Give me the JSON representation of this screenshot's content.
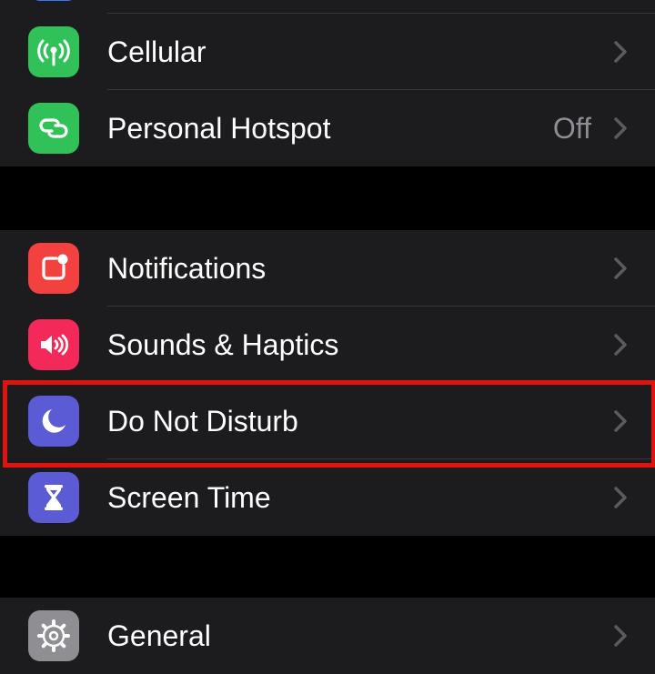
{
  "colors": {
    "background": "#000000",
    "cell": "#1c1c1e",
    "separator": "#38383a",
    "label": "#ffffff",
    "secondary": "#8d8d93",
    "highlight": "#e1120f"
  },
  "groups": [
    {
      "rows": [
        {
          "label": "Cellular",
          "icon": "antenna-icon",
          "color": "#30c158",
          "value": ""
        },
        {
          "label": "Personal Hotspot",
          "icon": "link-chain-icon",
          "color": "#30c158",
          "value": "Off"
        }
      ]
    },
    {
      "rows": [
        {
          "label": "Notifications",
          "icon": "notification-badge-icon",
          "color": "#f3413f",
          "value": ""
        },
        {
          "label": "Sounds & Haptics",
          "icon": "speaker-icon",
          "color": "#f32a59",
          "value": ""
        },
        {
          "label": "Do Not Disturb",
          "icon": "moon-icon",
          "color": "#5b5bd6",
          "value": ""
        },
        {
          "label": "Screen Time",
          "icon": "hourglass-icon",
          "color": "#5b5bd6",
          "value": ""
        }
      ]
    },
    {
      "rows": [
        {
          "label": "General",
          "icon": "gear-icon",
          "color": "#8e8e93",
          "value": ""
        }
      ]
    }
  ]
}
